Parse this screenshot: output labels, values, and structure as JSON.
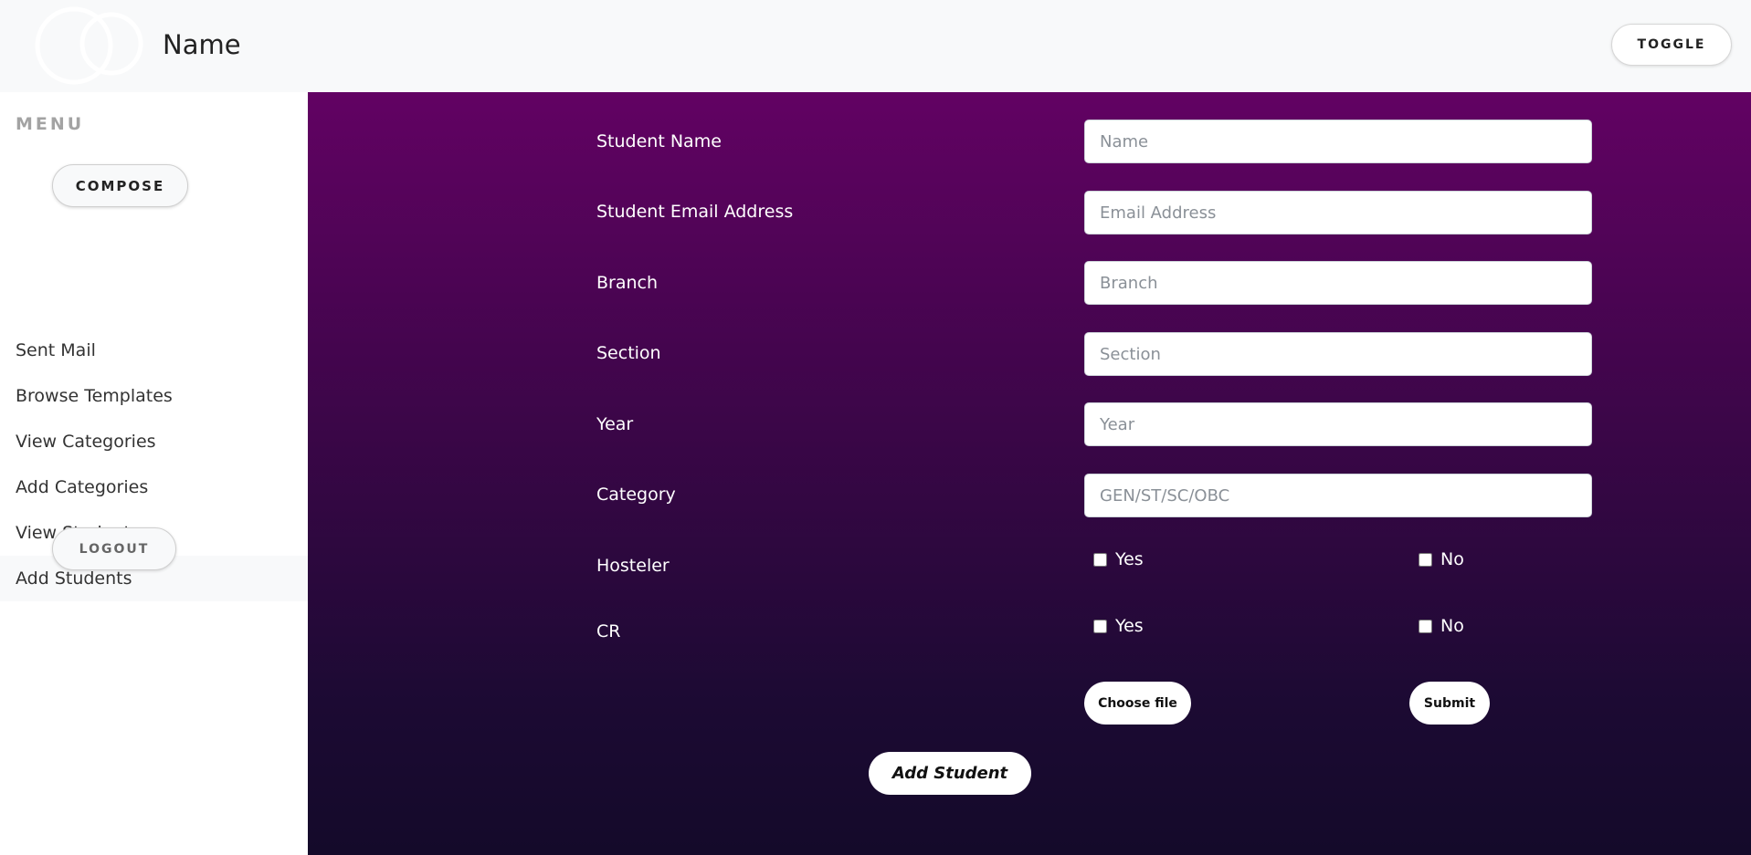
{
  "header": {
    "brand": "Name",
    "toggle_label": "TOGGLE"
  },
  "sidebar": {
    "menu_title": "MENU",
    "compose_label": "COMPOSE",
    "items": [
      {
        "label": "Sent Mail"
      },
      {
        "label": "Browse Templates"
      },
      {
        "label": "View Categories"
      },
      {
        "label": "Add Categories"
      },
      {
        "label": "View Students"
      },
      {
        "label": "Add Students",
        "active": true
      }
    ],
    "logout_label": "LOGOUT"
  },
  "form": {
    "fields": [
      {
        "label": "Student Name",
        "placeholder": "Name",
        "value": ""
      },
      {
        "label": "Student Email Address",
        "placeholder": "Email Address",
        "value": ""
      },
      {
        "label": "Branch",
        "placeholder": "Branch",
        "value": ""
      },
      {
        "label": "Section",
        "placeholder": "Section",
        "value": ""
      },
      {
        "label": "Year",
        "placeholder": "Year",
        "value": ""
      },
      {
        "label": "Category",
        "placeholder": "GEN/ST/SC/OBC",
        "value": ""
      }
    ],
    "hosteler": {
      "label": "Hosteler",
      "yes": "Yes",
      "no": "No",
      "yes_checked": false,
      "no_checked": false
    },
    "cr": {
      "label": "CR",
      "yes": "Yes",
      "no": "No",
      "yes_checked": false,
      "no_checked": false
    },
    "choose_file_label": "Choose file",
    "submit_label": "Submit",
    "add_student_label": "Add Student"
  },
  "colors": {
    "header_bg": "#f8f9fa",
    "gradient_top": "#620263",
    "gradient_bottom": "#140a2a",
    "menu_title": "#a3a3a3"
  }
}
